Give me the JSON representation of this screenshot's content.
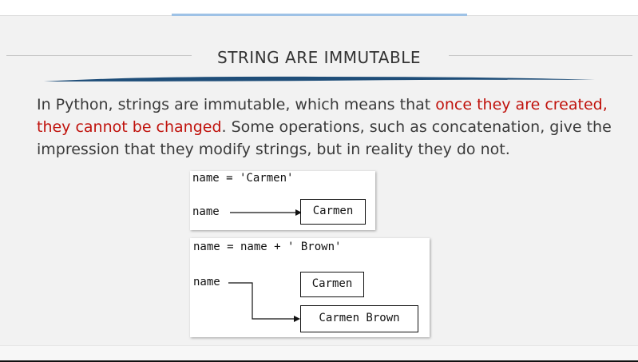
{
  "slide": {
    "title": "STRING ARE IMMUTABLE",
    "paragraph": {
      "part1": "In Python, strings are immutable, which means that ",
      "highlight": "once they are created, they cannot be changed",
      "part2": ". Some operations, such as concatenation, give the impression that they modify strings, but in reality they do not."
    },
    "colors": {
      "highlight": "#c0120c",
      "title_rule": "#1f4e79",
      "top_accent": "#9ec2e6"
    }
  },
  "diagram1": {
    "code": "name = 'Carmen'",
    "variable": "name",
    "value": "Carmen"
  },
  "diagram2": {
    "code": "name = name + ' Brown'",
    "variable": "name",
    "old_value": "Carmen",
    "new_value": "Carmen Brown"
  }
}
